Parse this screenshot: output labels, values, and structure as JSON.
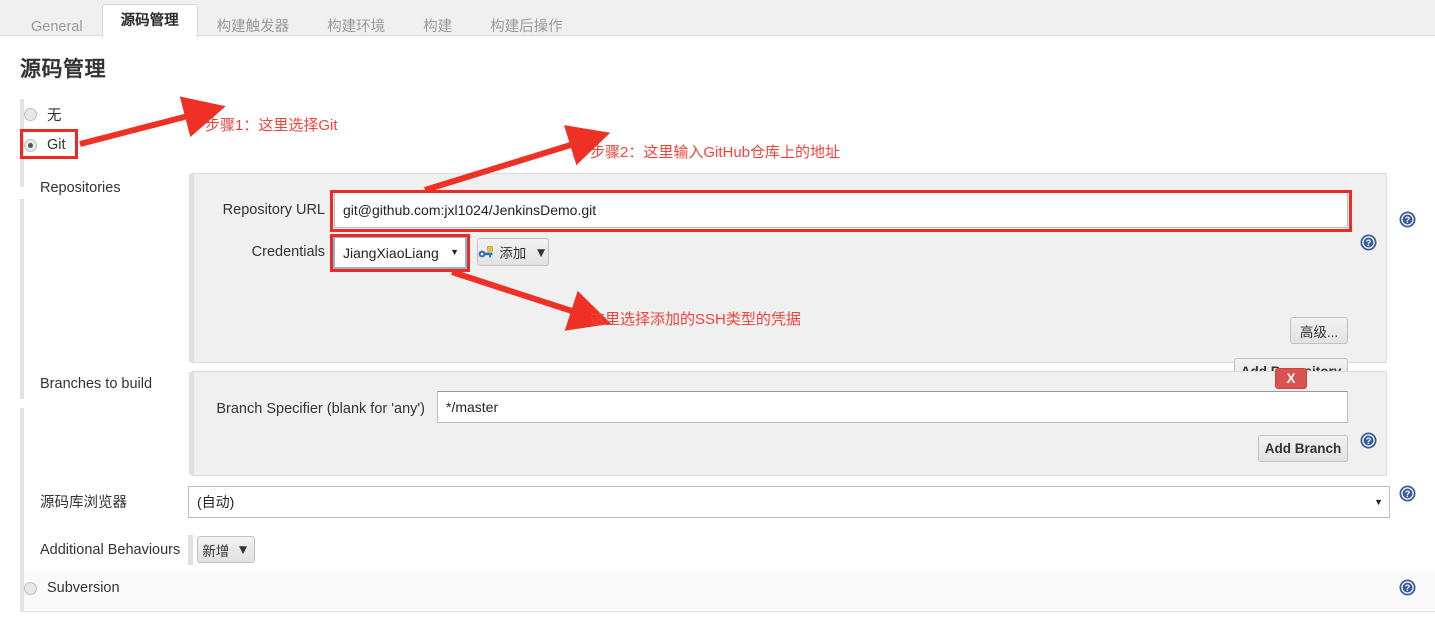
{
  "tabs": [
    {
      "label": "General",
      "active": false
    },
    {
      "label": "源码管理",
      "active": true
    },
    {
      "label": "构建触发器",
      "active": false
    },
    {
      "label": "构建环境",
      "active": false
    },
    {
      "label": "构建",
      "active": false
    },
    {
      "label": "构建后操作",
      "active": false
    }
  ],
  "page": {
    "title": "源码管理"
  },
  "scm_options": [
    {
      "label": "无",
      "selected": false
    },
    {
      "label": "Git",
      "selected": true
    },
    {
      "label": "Subversion",
      "selected": false
    }
  ],
  "repositories": {
    "section_label": "Repositories",
    "url_label": "Repository URL",
    "url_value": "git@github.com:jxl1024/JenkinsDemo.git",
    "url_placeholder": "",
    "credentials_label": "Credentials",
    "credentials_value": "JiangXiaoLiang",
    "add_credentials_label": "添加",
    "advanced_label": "高级...",
    "add_repository_label": "Add Repository"
  },
  "branches": {
    "section_label": "Branches to build",
    "specifier_label": "Branch Specifier (blank for 'any')",
    "specifier_value": "*/master",
    "delete_label": "X",
    "add_branch_label": "Add Branch"
  },
  "browser": {
    "label": "源码库浏览器",
    "value": "(自动)"
  },
  "additional": {
    "label": "Additional Behaviours",
    "add_label": "新增"
  },
  "annotations": [
    {
      "text": "步骤1：这里选择Git"
    },
    {
      "text": "步骤2：这里输入GitHub仓库上的地址"
    },
    {
      "text": "这里选择添加的SSH类型的凭据"
    }
  ],
  "colors": {
    "annotation_red": "#f2433a",
    "highlight_red": "#ee2b22",
    "delete_red": "#d9534f",
    "help_blue": "#3b5c99"
  },
  "icons": {
    "help": "help-icon",
    "key": "key-icon",
    "caret": "▾"
  }
}
